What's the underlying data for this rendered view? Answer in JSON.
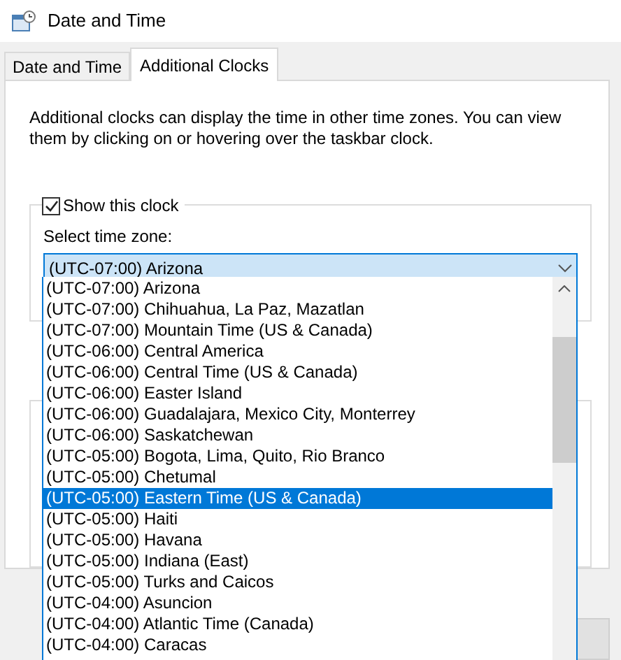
{
  "window": {
    "title": "Date and Time"
  },
  "tabs": [
    {
      "label": "Date and Time",
      "selected": false
    },
    {
      "label": "Additional Clocks",
      "selected": true
    }
  ],
  "description": "Additional clocks can display the time in other time zones. You can view them by clicking on or hovering over the taskbar clock.",
  "clock": {
    "show": {
      "label": "Show this clock",
      "checked": true
    },
    "timezone_label": "Select time zone:",
    "timezone": {
      "value": "(UTC-07:00) Arizona",
      "expanded": true,
      "options": [
        {
          "label": "(UTC-07:00) Arizona",
          "highlighted": false
        },
        {
          "label": "(UTC-07:00) Chihuahua, La Paz, Mazatlan",
          "highlighted": false
        },
        {
          "label": "(UTC-07:00) Mountain Time (US & Canada)",
          "highlighted": false
        },
        {
          "label": "(UTC-06:00) Central America",
          "highlighted": false
        },
        {
          "label": "(UTC-06:00) Central Time (US & Canada)",
          "highlighted": false
        },
        {
          "label": "(UTC-06:00) Easter Island",
          "highlighted": false
        },
        {
          "label": "(UTC-06:00) Guadalajara, Mexico City, Monterrey",
          "highlighted": false
        },
        {
          "label": "(UTC-06:00) Saskatchewan",
          "highlighted": false
        },
        {
          "label": "(UTC-05:00) Bogota, Lima, Quito, Rio Branco",
          "highlighted": false
        },
        {
          "label": "(UTC-05:00) Chetumal",
          "highlighted": false
        },
        {
          "label": "(UTC-05:00) Eastern Time (US & Canada)",
          "highlighted": true
        },
        {
          "label": "(UTC-05:00) Haiti",
          "highlighted": false
        },
        {
          "label": "(UTC-05:00) Havana",
          "highlighted": false
        },
        {
          "label": "(UTC-05:00) Indiana (East)",
          "highlighted": false
        },
        {
          "label": "(UTC-05:00) Turks and Caicos",
          "highlighted": false
        },
        {
          "label": "(UTC-04:00) Asuncion",
          "highlighted": false
        },
        {
          "label": "(UTC-04:00) Atlantic Time (Canada)",
          "highlighted": false
        },
        {
          "label": "(UTC-04:00) Caracas",
          "highlighted": false
        }
      ]
    }
  }
}
